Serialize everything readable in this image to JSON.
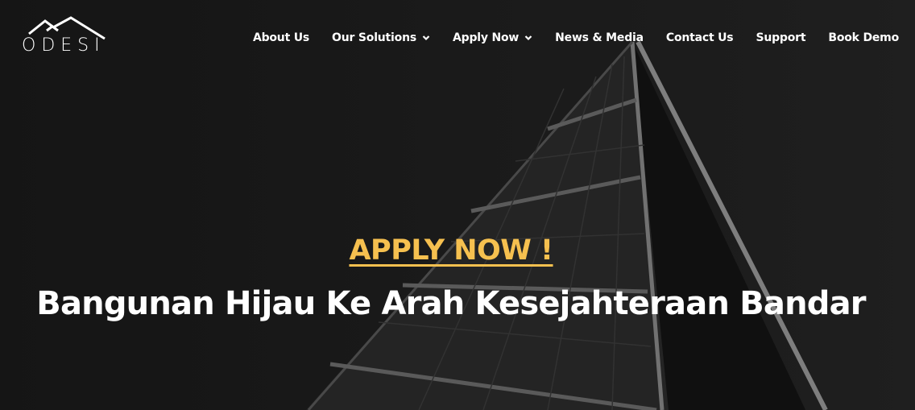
{
  "brand": {
    "logo_text": "ODESI"
  },
  "nav": {
    "about": "About Us",
    "solutions": "Our Solutions",
    "apply": "Apply Now",
    "news": "News & Media",
    "contact": "Contact Us",
    "support": "Support",
    "demo": "Book Demo"
  },
  "icons": {
    "dropdown": "chevron-down-icon",
    "logo_roofs": "house-roof-icon"
  },
  "hero": {
    "cta_label": "APPLY NOW !",
    "headline": "Bangunan Hijau Ke Arah Kesejahteraan Bandar"
  },
  "colors": {
    "background": "#1c1c1c",
    "cta": "#f6c04f",
    "text": "#ffffff"
  }
}
